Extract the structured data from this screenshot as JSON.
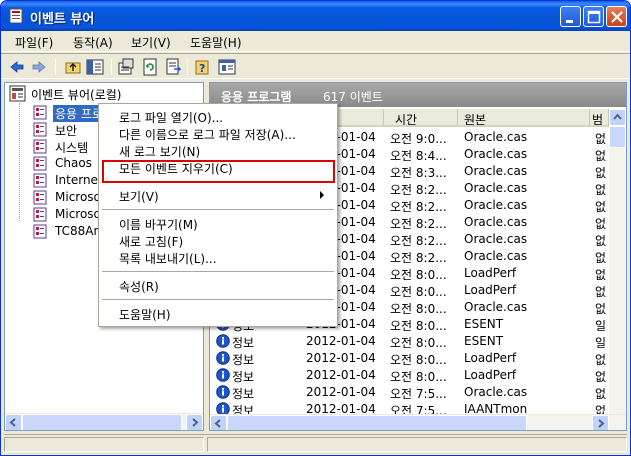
{
  "window": {
    "title": "이벤트 뷰어"
  },
  "menubar": {
    "items": [
      "파일(F)",
      "동작(A)",
      "보기(V)",
      "도움말(H)"
    ]
  },
  "toolbar": {
    "icons": [
      "back-arrow-icon",
      "forward-arrow-icon",
      "up-folder-icon",
      "show-hide-tree-icon",
      "properties-icon",
      "refresh-icon",
      "export-list-icon",
      "help-icon",
      "console-icon"
    ]
  },
  "tree": {
    "root_label": "이벤트 뷰어(로컬)",
    "items": [
      {
        "label": "응용 프로그램",
        "selected": true
      },
      {
        "label": "보안",
        "selected": false
      },
      {
        "label": "시스템",
        "selected": false
      },
      {
        "label": "Chaos",
        "selected": false
      },
      {
        "label": "Internet E",
        "selected": false
      },
      {
        "label": "Microsof",
        "selected": false
      },
      {
        "label": "Microsof",
        "selected": false
      },
      {
        "label": "TC88Ana",
        "selected": false
      }
    ]
  },
  "list": {
    "title": "응용 프로그램",
    "count": "617 이벤트",
    "columns": [
      "형식",
      "날짜",
      "시간",
      "원본",
      "범"
    ],
    "rows": [
      {
        "type": "",
        "date": "2012-01-04",
        "time": "오전 9:0...",
        "source": "Oracle.cas",
        "extra": "없"
      },
      {
        "type": "",
        "date": "2012-01-04",
        "time": "오전 8:4...",
        "source": "Oracle.cas",
        "extra": "없"
      },
      {
        "type": "",
        "date": "2012-01-04",
        "time": "오전 8:3...",
        "source": "Oracle.cas",
        "extra": "없"
      },
      {
        "type": "",
        "date": "2012-01-04",
        "time": "오전 8:2...",
        "source": "Oracle.cas",
        "extra": "없"
      },
      {
        "type": "",
        "date": "2012-01-04",
        "time": "오전 8:2...",
        "source": "Oracle.cas",
        "extra": "없"
      },
      {
        "type": "",
        "date": "2012-01-04",
        "time": "오전 8:2...",
        "source": "Oracle.cas",
        "extra": "없"
      },
      {
        "type": "",
        "date": "2012-01-04",
        "time": "오전 8:2...",
        "source": "Oracle.cas",
        "extra": "없"
      },
      {
        "type": "",
        "date": "2012-01-04",
        "time": "오전 8:2...",
        "source": "Oracle.cas",
        "extra": "없"
      },
      {
        "type": "",
        "date": "2012-01-04",
        "time": "오전 8:0...",
        "source": "LoadPerf",
        "extra": "없"
      },
      {
        "type": "",
        "date": "2012-01-04",
        "time": "오전 8:0...",
        "source": "LoadPerf",
        "extra": "없"
      },
      {
        "type": "",
        "date": "2012-01-04",
        "time": "오전 8:0...",
        "source": "Oracle.cas",
        "extra": "없"
      },
      {
        "type": "정보",
        "date": "2012-01-04",
        "time": "오전 8:0...",
        "source": "ESENT",
        "extra": "일"
      },
      {
        "type": "정보",
        "date": "2012-01-04",
        "time": "오전 8:0...",
        "source": "ESENT",
        "extra": "일"
      },
      {
        "type": "정보",
        "date": "2012-01-04",
        "time": "오전 8:0...",
        "source": "LoadPerf",
        "extra": "없"
      },
      {
        "type": "정보",
        "date": "2012-01-04",
        "time": "오전 8:0...",
        "source": "LoadPerf",
        "extra": "없"
      },
      {
        "type": "정보",
        "date": "2012-01-04",
        "time": "오전 7:5...",
        "source": "Oracle.cas",
        "extra": "없"
      },
      {
        "type": "정보",
        "date": "2012-01-04",
        "time": "오전 7:5...",
        "source": "IAANTmon",
        "extra": "없"
      }
    ]
  },
  "context_menu": {
    "items": [
      {
        "label": "로그 파일 열기(O)...",
        "kind": "item"
      },
      {
        "label": "다른 이름으로 로그 파일 저장(A)...",
        "kind": "item"
      },
      {
        "label": "새 로그 보기(N)",
        "kind": "item"
      },
      {
        "label": "모든 이벤트 지우기(C)",
        "kind": "item",
        "highlighted": true
      },
      {
        "kind": "separator"
      },
      {
        "label": "보기(V)",
        "kind": "submenu"
      },
      {
        "kind": "separator"
      },
      {
        "label": "이름 바꾸기(M)",
        "kind": "item"
      },
      {
        "label": "새로 고침(F)",
        "kind": "item"
      },
      {
        "label": "목록 내보내기(L)...",
        "kind": "item"
      },
      {
        "kind": "separator"
      },
      {
        "label": "속성(R)",
        "kind": "item"
      },
      {
        "kind": "separator"
      },
      {
        "label": "도움말(H)",
        "kind": "item"
      }
    ]
  },
  "colors": {
    "titlebar": "#0454d4",
    "selection": "#316ac5",
    "highlight_border": "#e00000",
    "info_icon": "#1f55c8"
  }
}
